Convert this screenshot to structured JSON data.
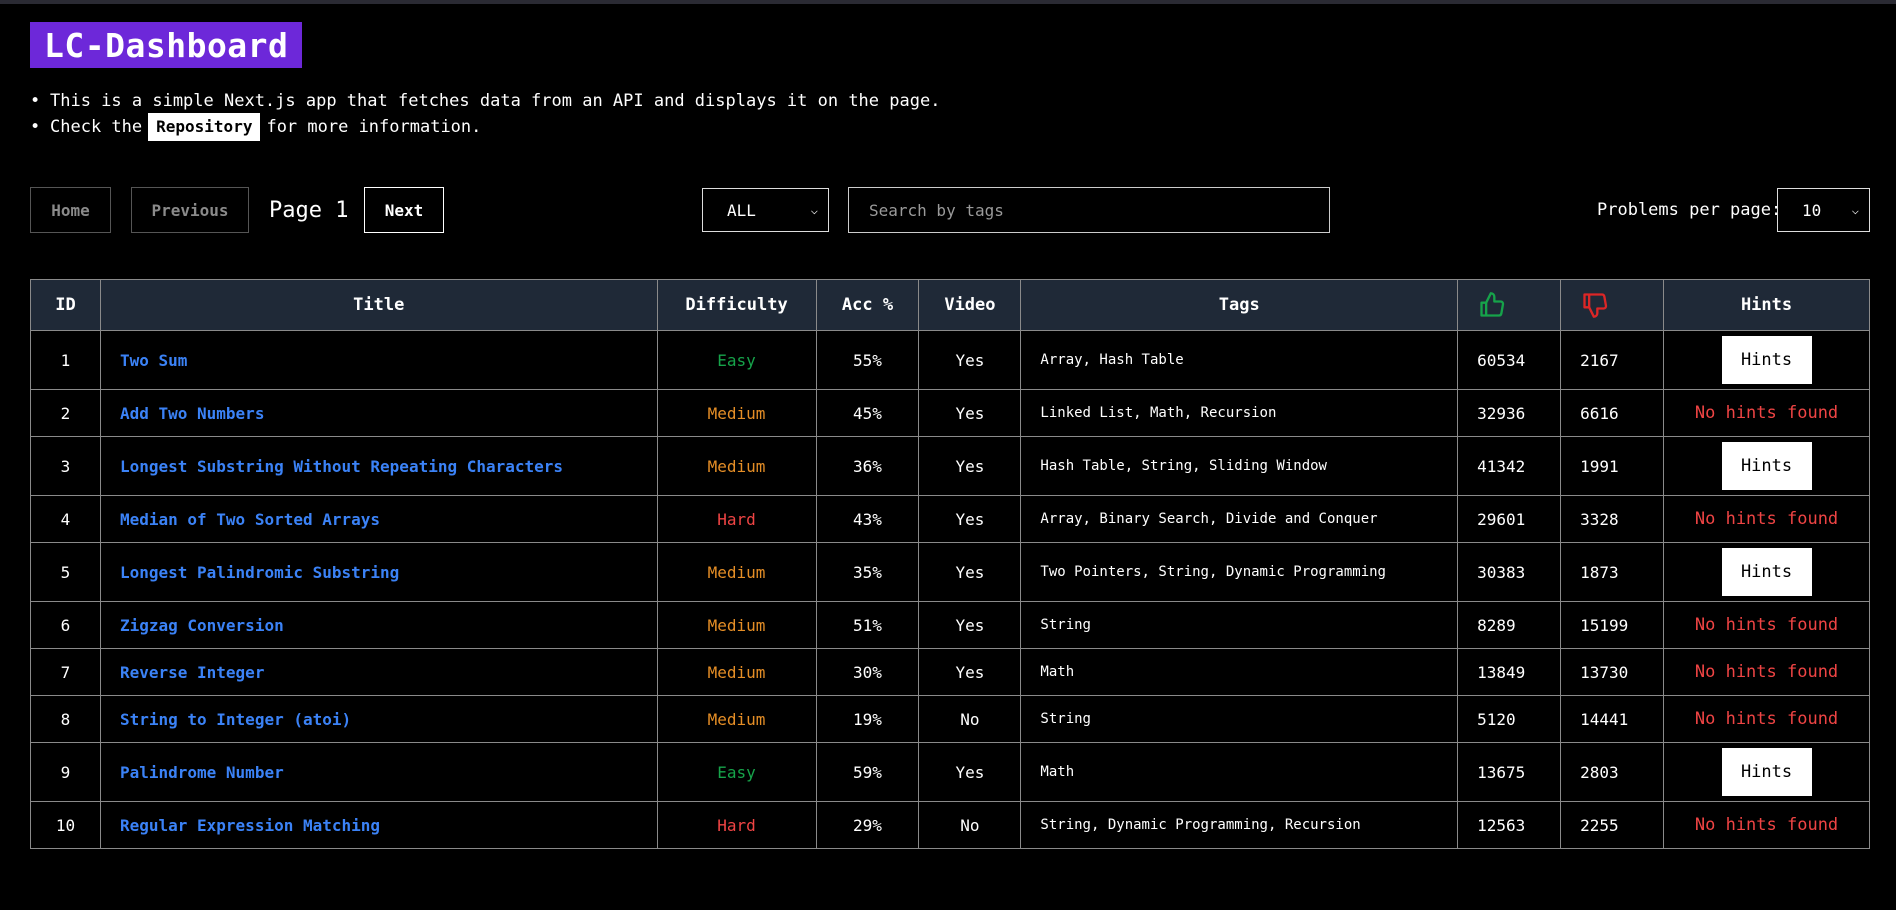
{
  "app": {
    "title": "LC-Dashboard",
    "intro_line1": "This is a simple Next.js app that fetches data from an API and displays it on the page.",
    "intro_line2_prefix": "Check the",
    "repo_link": "Repository",
    "intro_line2_suffix": "for more information."
  },
  "controls": {
    "home": "Home",
    "previous": "Previous",
    "page_label": "Page 1",
    "next": "Next",
    "difficulty_selected": "ALL",
    "search_placeholder": "Search by tags",
    "per_page_label": "Problems per page:",
    "per_page_selected": "10"
  },
  "table": {
    "headers": {
      "id": "ID",
      "title": "Title",
      "difficulty": "Difficulty",
      "acc": "Acc %",
      "video": "Video",
      "tags": "Tags",
      "likes_icon": "thumbs-up-icon",
      "dislikes_icon": "thumbs-down-icon",
      "hints": "Hints"
    },
    "rows": [
      {
        "id": "1",
        "title": "Two Sum",
        "difficulty": "Easy",
        "acc": "55%",
        "video": "Yes",
        "tags": "Array, Hash Table",
        "likes": "60534",
        "dislikes": "2167",
        "hints": "Hints"
      },
      {
        "id": "2",
        "title": "Add Two Numbers",
        "difficulty": "Medium",
        "acc": "45%",
        "video": "Yes",
        "tags": "Linked List, Math, Recursion",
        "likes": "32936",
        "dislikes": "6616",
        "hints": "No hints found"
      },
      {
        "id": "3",
        "title": "Longest Substring Without Repeating Characters",
        "difficulty": "Medium",
        "acc": "36%",
        "video": "Yes",
        "tags": "Hash Table, String, Sliding Window",
        "likes": "41342",
        "dislikes": "1991",
        "hints": "Hints"
      },
      {
        "id": "4",
        "title": "Median of Two Sorted Arrays",
        "difficulty": "Hard",
        "acc": "43%",
        "video": "Yes",
        "tags": "Array, Binary Search, Divide and Conquer",
        "likes": "29601",
        "dislikes": "3328",
        "hints": "No hints found"
      },
      {
        "id": "5",
        "title": "Longest Palindromic Substring",
        "difficulty": "Medium",
        "acc": "35%",
        "video": "Yes",
        "tags": "Two Pointers, String, Dynamic Programming",
        "likes": "30383",
        "dislikes": "1873",
        "hints": "Hints"
      },
      {
        "id": "6",
        "title": "Zigzag Conversion",
        "difficulty": "Medium",
        "acc": "51%",
        "video": "Yes",
        "tags": "String",
        "likes": "8289",
        "dislikes": "15199",
        "hints": "No hints found"
      },
      {
        "id": "7",
        "title": "Reverse Integer",
        "difficulty": "Medium",
        "acc": "30%",
        "video": "Yes",
        "tags": "Math",
        "likes": "13849",
        "dislikes": "13730",
        "hints": "No hints found"
      },
      {
        "id": "8",
        "title": "String to Integer (atoi)",
        "difficulty": "Medium",
        "acc": "19%",
        "video": "No",
        "tags": "String",
        "likes": "5120",
        "dislikes": "14441",
        "hints": "No hints found"
      },
      {
        "id": "9",
        "title": "Palindrome Number",
        "difficulty": "Easy",
        "acc": "59%",
        "video": "Yes",
        "tags": "Math",
        "likes": "13675",
        "dislikes": "2803",
        "hints": "Hints"
      },
      {
        "id": "10",
        "title": "Regular Expression Matching",
        "difficulty": "Hard",
        "acc": "29%",
        "video": "No",
        "tags": "String, Dynamic Programming, Recursion",
        "likes": "12563",
        "dislikes": "2255",
        "hints": "No hints found"
      }
    ]
  },
  "colors": {
    "brand": "#6d28d9",
    "link": "#3b82f6",
    "easy": "#16a34a",
    "medium": "#e58e26",
    "hard": "#ef4444",
    "header_bg": "#1f2937"
  }
}
